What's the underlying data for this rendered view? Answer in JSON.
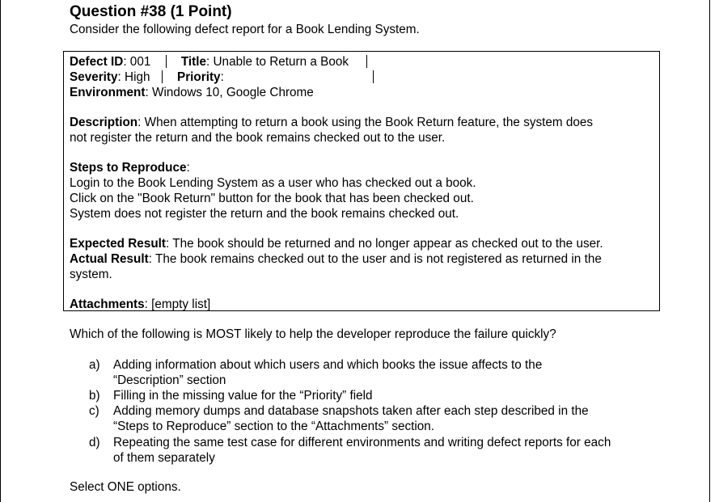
{
  "question": {
    "title": "Question #38 (1 Point)",
    "intro": "Consider the following defect report for a Book Lending System."
  },
  "report": {
    "defect_id_label": "Defect ID",
    "defect_id_value": ": 001",
    "title_label": "Title",
    "title_value": ": Unable to Return a Book",
    "severity_label": "Severity",
    "severity_value": ": High",
    "priority_label": "Priority",
    "priority_value": ":",
    "environment_label": "Environment",
    "environment_value": ": Windows 10, Google Chrome",
    "description_label": "Description",
    "description_line1": ": When attempting to return a book using the Book Return feature, the system does",
    "description_line2": "not register the return and the book remains checked out to the user.",
    "steps_label": "Steps to Reproduce",
    "steps_colon": ":",
    "steps": [
      "Login to the Book Lending System as a user who has checked out a book.",
      "Click on the \"Book Return\" button for the book that has been checked out.",
      "System does not register the return and the book remains checked out."
    ],
    "expected_label": "Expected Result",
    "expected_value": ": The book should be returned and no longer appear as checked out to the user.",
    "actual_label": "Actual Result",
    "actual_value_line1": ": The book remains checked out to the user and is not registered as returned in the",
    "actual_value_line2": "system.",
    "attachments_label": "Attachments",
    "attachments_value": ": [empty list]"
  },
  "prompt": "Which of the following is MOST likely to help the developer reproduce the failure quickly?",
  "options": [
    {
      "letter": "a)",
      "line1": "Adding information about which users and which books the issue affects to the",
      "line2": "“Description” section"
    },
    {
      "letter": "b)",
      "line1": "Filling in the missing value for the “Priority” field",
      "line2": ""
    },
    {
      "letter": "c)",
      "line1": "Adding memory dumps and database snapshots taken after each step described in the",
      "line2": "“Steps to Reproduce” section to the “Attachments” section."
    },
    {
      "letter": "d)",
      "line1": "Repeating the same test case for different environments and writing defect reports for each",
      "line2": "of them separately"
    }
  ],
  "instruction": "Select ONE options."
}
